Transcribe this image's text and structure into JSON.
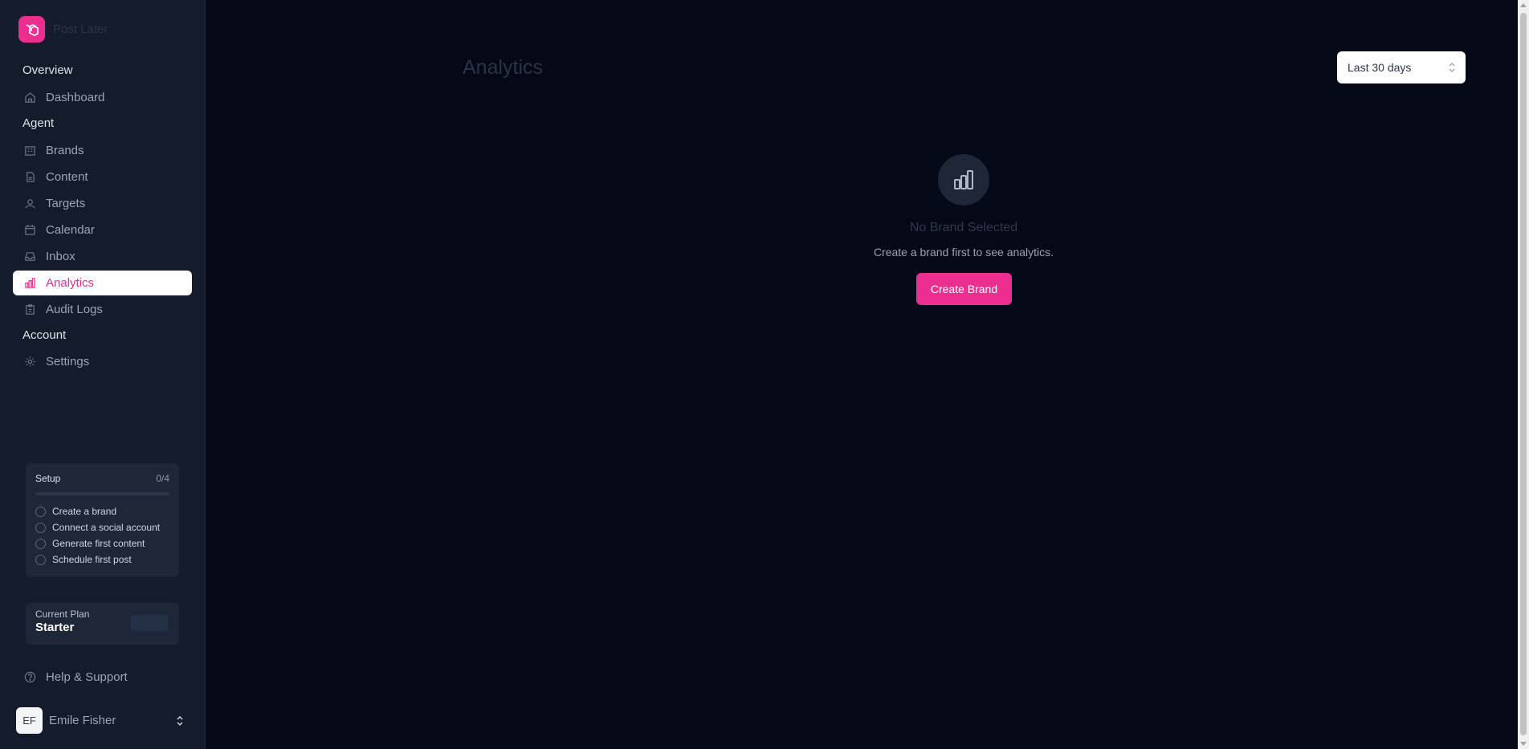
{
  "app": {
    "name": "Post Later"
  },
  "sidebar": {
    "sections": [
      {
        "label": "Overview"
      },
      {
        "label": "Agent"
      },
      {
        "label": "Account"
      }
    ],
    "items": [
      {
        "label": "Dashboard",
        "icon": "home-icon"
      },
      {
        "label": "Brands",
        "icon": "building-icon"
      },
      {
        "label": "Content",
        "icon": "document-icon"
      },
      {
        "label": "Targets",
        "icon": "target-icon"
      },
      {
        "label": "Calendar",
        "icon": "calendar-icon"
      },
      {
        "label": "Inbox",
        "icon": "inbox-icon"
      },
      {
        "label": "Analytics",
        "icon": "bar-chart-icon",
        "active": true
      },
      {
        "label": "Audit Logs",
        "icon": "clipboard-icon"
      },
      {
        "label": "Settings",
        "icon": "gear-icon"
      }
    ],
    "setup": {
      "title": "Setup",
      "count": "0/4",
      "progress": 0,
      "steps": [
        "Create a brand",
        "Connect a social account",
        "Generate first content",
        "Schedule first post"
      ]
    },
    "plan": {
      "label": "Current Plan",
      "name": "Starter"
    },
    "help": {
      "label": "Help & Support"
    },
    "user": {
      "initials": "EF",
      "name": "Emile Fisher"
    }
  },
  "main": {
    "title": "Analytics",
    "range": {
      "selected": "Last 30 days"
    },
    "empty_state": {
      "title": "No Brand Selected",
      "message": "Create a brand first to see analytics.",
      "button": "Create Brand"
    }
  },
  "colors": {
    "accent": "#ec2f8f",
    "background": "#050816",
    "sidebar": "#141c2c"
  }
}
